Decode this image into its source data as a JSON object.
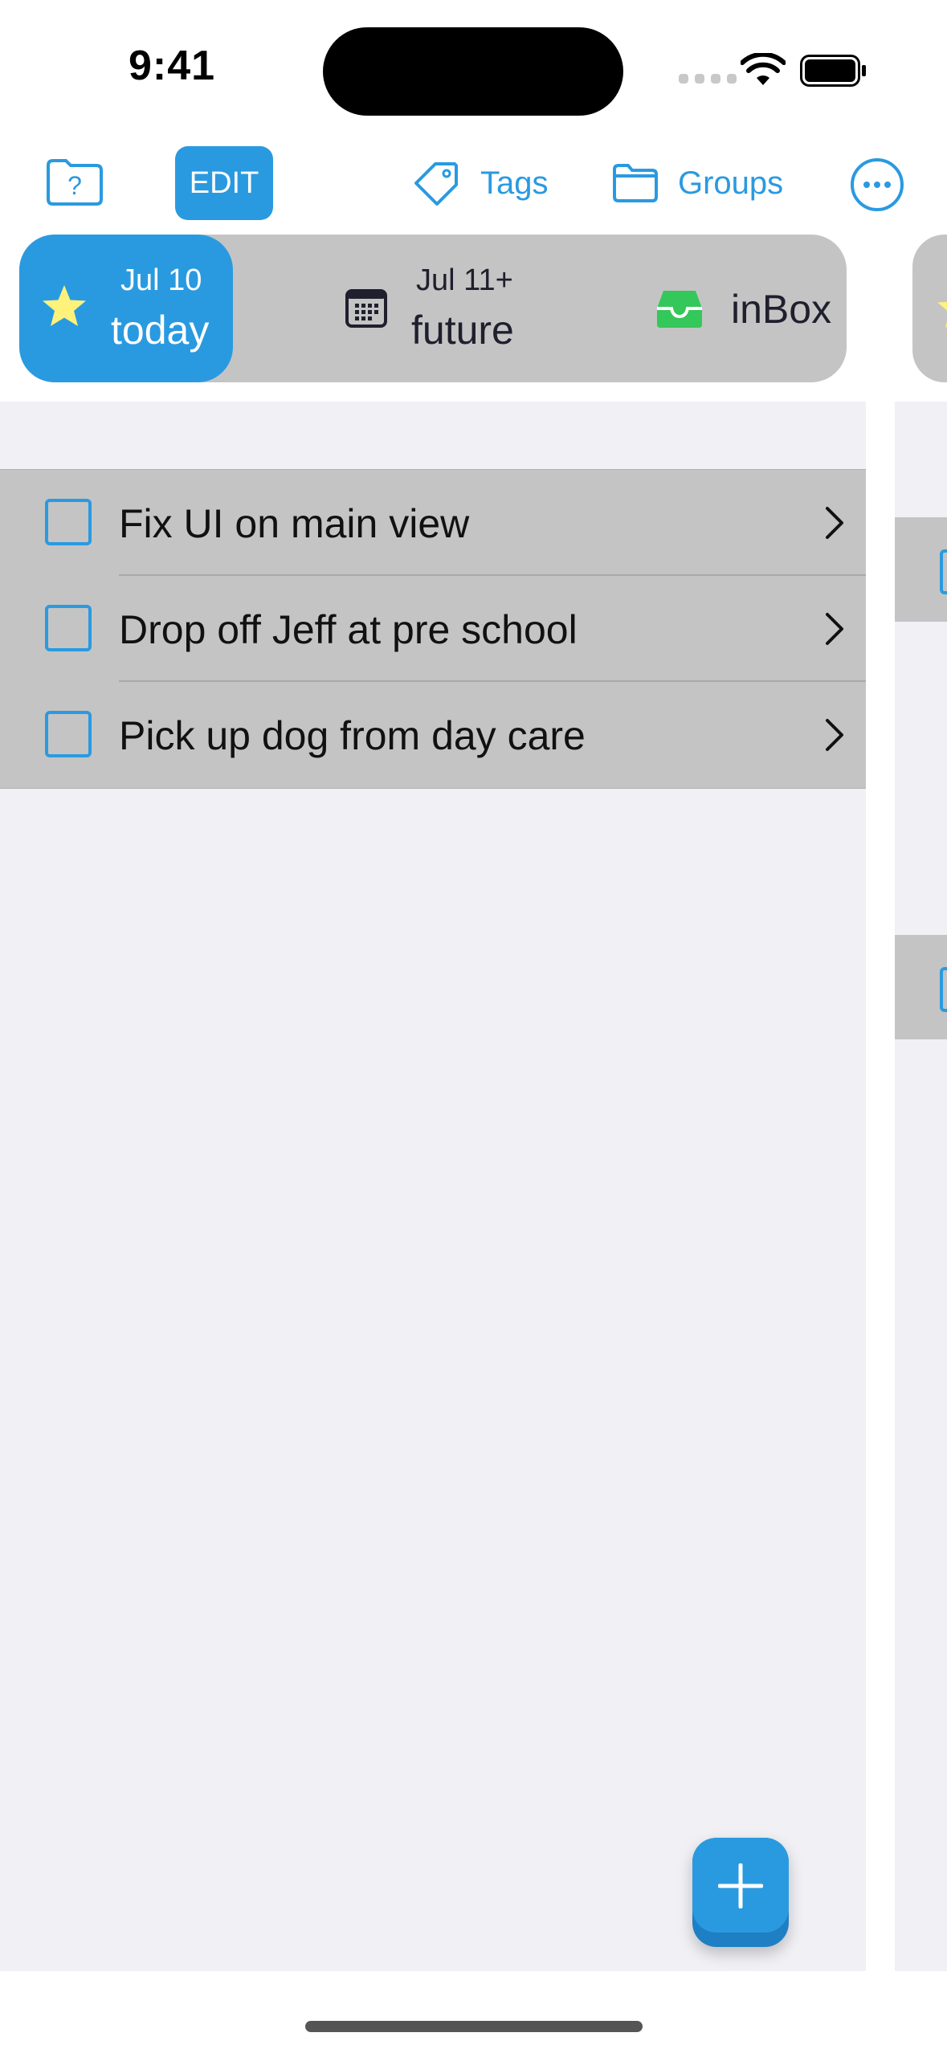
{
  "status_bar": {
    "time": "9:41"
  },
  "toolbar": {
    "edit_label": "EDIT",
    "tags_label": "Tags",
    "groups_label": "Groups"
  },
  "filters": {
    "today": {
      "date": "Jul 10",
      "label": "today"
    },
    "future": {
      "date": "Jul 11+",
      "label": "future"
    },
    "inbox": {
      "label": "inBox"
    }
  },
  "tasks": [
    {
      "title": "Fix UI on main view",
      "done": false
    },
    {
      "title": "Drop off Jeff at pre school",
      "done": false
    },
    {
      "title": "Pick up dog from day care",
      "done": false
    }
  ],
  "colors": {
    "accent": "#2a9ae0",
    "segment_bg": "#c4c4c4",
    "list_bg": "#f0f0f5",
    "star": "#fff27a",
    "inbox_green": "#34c759"
  },
  "icons": {
    "help": "folder-question-icon",
    "tags": "tag-icon",
    "groups": "folder-icon",
    "more": "ellipsis-circle-icon",
    "today": "star-icon",
    "future": "calendar-icon",
    "inbox": "tray-icon",
    "add": "plus-icon"
  }
}
